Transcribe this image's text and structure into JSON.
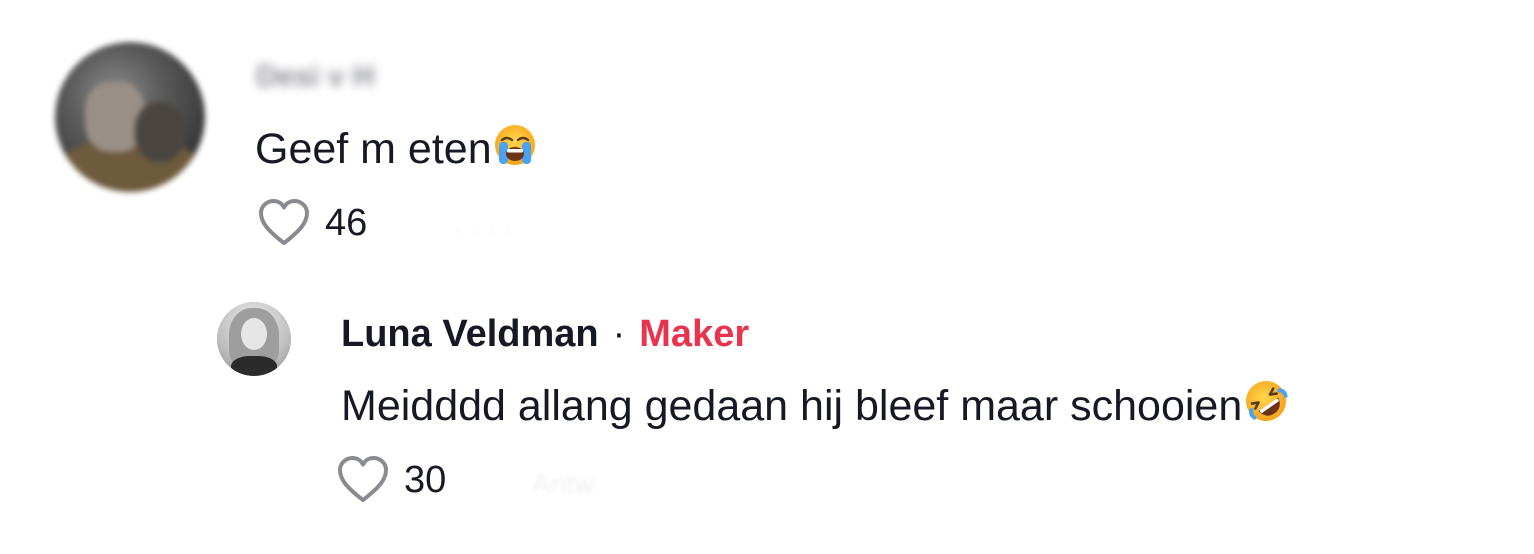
{
  "comment": {
    "username": "Desi v H",
    "text": "Geef m eten",
    "emoji": "loudly-crying-face-emoji",
    "likes": "46",
    "faint_meta": "· · · ·"
  },
  "reply": {
    "username": "Luna Veldman",
    "separator": "·",
    "badge": "Maker",
    "text": "Meidddd allang gedaan hij bleef maar schooien",
    "emoji": "rolling-on-floor-laughing-emoji",
    "likes": "30",
    "faint_meta": "Antw"
  },
  "colors": {
    "text": "#161823",
    "badge": "#e8344f",
    "heart_outline": "#8a8b91"
  }
}
